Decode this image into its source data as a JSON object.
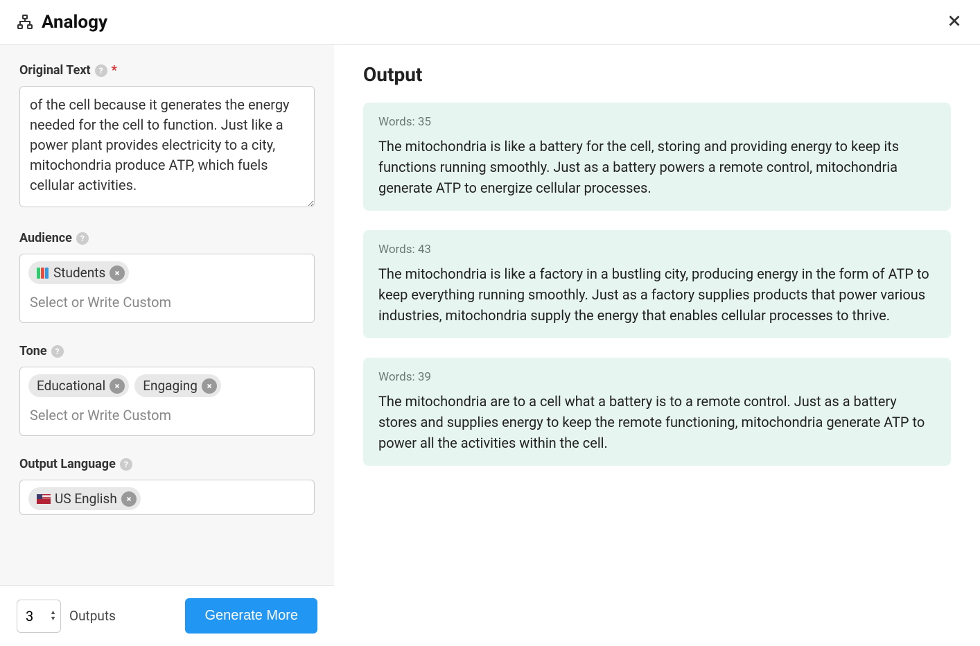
{
  "header": {
    "title": "Analogy"
  },
  "sidebar": {
    "original_text": {
      "label": "Original Text",
      "value": "of the cell because it generates the energy needed for the cell to function. Just like a power plant provides electricity to a city, mitochondria produce ATP, which fuels cellular activities."
    },
    "audience": {
      "label": "Audience",
      "placeholder": "Select or Write Custom",
      "tags": [
        {
          "label": "Students",
          "icon": "books"
        }
      ]
    },
    "tone": {
      "label": "Tone",
      "placeholder": "Select or Write Custom",
      "tags": [
        {
          "label": "Educational"
        },
        {
          "label": "Engaging"
        }
      ]
    },
    "output_language": {
      "label": "Output Language",
      "tags": [
        {
          "label": "US English",
          "icon": "flag-us"
        }
      ]
    }
  },
  "output": {
    "title": "Output",
    "cards": [
      {
        "words_label": "Words: 35",
        "text": "The mitochondria is like a battery for the cell, storing and providing energy to keep its functions running smoothly. Just as a battery powers a remote control, mitochondria generate ATP to energize cellular processes."
      },
      {
        "words_label": "Words: 43",
        "text": "The mitochondria is like a factory in a bustling city, producing energy in the form of ATP to keep everything running smoothly. Just as a factory supplies products that power various industries, mitochondria supply the energy that enables cellular processes to thrive."
      },
      {
        "words_label": "Words: 39",
        "text": "The mitochondria are to a cell what a battery is to a remote control. Just as a battery stores and supplies energy to keep the remote functioning, mitochondria generate ATP to power all the activities within the cell."
      }
    ]
  },
  "footer": {
    "outputs_count": "3",
    "outputs_label": "Outputs",
    "generate_label": "Generate More"
  }
}
